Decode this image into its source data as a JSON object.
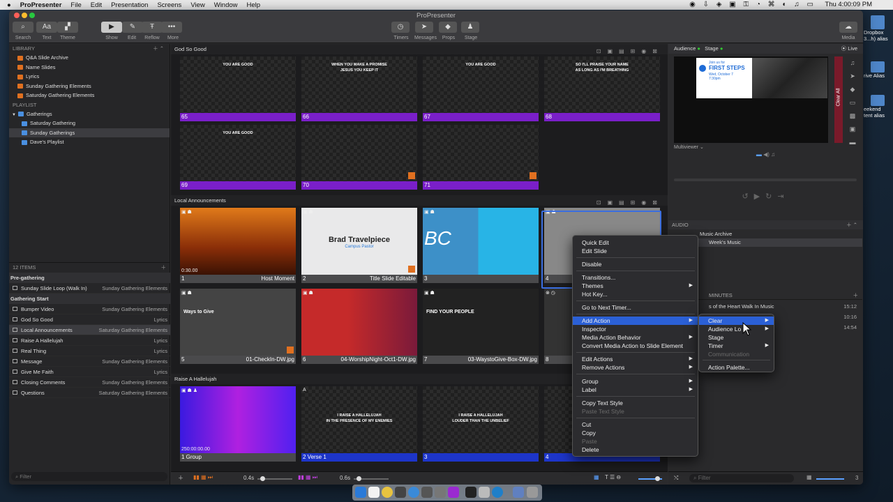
{
  "menubar": {
    "app": "ProPresenter",
    "items": [
      "File",
      "Edit",
      "Presentation",
      "Screens",
      "View",
      "Window",
      "Help"
    ],
    "clock": "Thu 4:00:09 PM"
  },
  "window": {
    "title": "ProPresenter"
  },
  "toolbar": {
    "left": [
      "Search",
      "Text",
      "Theme"
    ],
    "mid": [
      "Show",
      "Edit",
      "Reflow",
      "More"
    ],
    "center": [
      "Timers",
      "Messages",
      "Props",
      "Stage"
    ],
    "right": "Media"
  },
  "library": {
    "header": "LIBRARY",
    "items": [
      "Q&A Slide Archive",
      "Name Slides",
      "Lyrics",
      "Sunday Gathering Elements",
      "Saturday Gathering Elements"
    ]
  },
  "playlist": {
    "header": "PLAYLIST",
    "folder": "Gatherings",
    "items": [
      "Saturday Gathering",
      "Sunday Gatherings",
      "Dave's Playlist"
    ]
  },
  "pl_items": {
    "count": "12 ITEMS",
    "groups": [
      {
        "name": "Pre-gathering",
        "rows": [
          {
            "t": "Sunday Slide Loop (Walk In)",
            "r": "Sunday Gathering Elements"
          }
        ]
      },
      {
        "name": "Gathering Start",
        "rows": [
          {
            "t": "Bumper Video",
            "r": "Sunday Gathering Elements"
          },
          {
            "t": "God So Good",
            "r": "Lyrics"
          },
          {
            "t": "Local Announcements",
            "r": "Saturday Gathering Elements"
          },
          {
            "t": "Raise A Hallelujah",
            "r": "Lyrics"
          },
          {
            "t": "Real Thing",
            "r": "Lyrics"
          },
          {
            "t": "Message",
            "r": "Sunday Gathering Elements"
          },
          {
            "t": "Give Me Faith",
            "r": "Lyrics"
          },
          {
            "t": "Closing Comments",
            "r": "Sunday Gathering Elements"
          },
          {
            "t": "Questions",
            "r": "Saturday Gathering Elements"
          }
        ]
      }
    ]
  },
  "filter": "Filter",
  "sections": [
    "God So Good",
    "Local Announcements",
    "Raise A Hallelujah"
  ],
  "slides_a": [
    {
      "n": "65",
      "lyric": "YOU ARE GOOD"
    },
    {
      "n": "66",
      "lyric": "WHEN YOU MAKE A PROMISE\nJESUS YOU KEEP IT"
    },
    {
      "n": "67",
      "lyric": "YOU ARE GOOD"
    },
    {
      "n": "68",
      "lyric": "SO I'LL PRAISE YOUR NAME\nAS LONG AS I'M BREATHING"
    },
    {
      "n": "69",
      "lyric": "YOU ARE GOOD"
    },
    {
      "n": "70",
      "lyric": ""
    },
    {
      "n": "71",
      "lyric": ""
    }
  ],
  "slides_b": [
    {
      "n": "1",
      "name": "Host Moment",
      "time": "0:30.00"
    },
    {
      "n": "2",
      "name": "Title Slide Editable",
      "title": "Brad Travelpiece",
      "sub": "Campus Pastor"
    },
    {
      "n": "3",
      "name": "",
      "logo": "BC"
    },
    {
      "n": "4",
      "name": ""
    },
    {
      "n": "5",
      "name": "01-CheckIn-DW.jpg",
      "txt": "Ways to Give"
    },
    {
      "n": "6",
      "name": "04-WorshipNight-Oct1-DW.jpg"
    },
    {
      "n": "7",
      "name": "03-WaystoGive-Box-DW.jpg",
      "txt": "FIND YOUR PEOPLE"
    },
    {
      "n": "8",
      "name": ""
    }
  ],
  "slides_c": [
    {
      "n": "1",
      "name": "Group",
      "time": "250:00:00.00"
    },
    {
      "n": "2",
      "name": "Verse 1",
      "lyric": "I RAISE A HALLELUJAH\nIN THE PRESENCE OF MY ENEMIES"
    },
    {
      "n": "3",
      "name": "",
      "lyric": "I RAISE A HALLELUJAH\nLOUDER THAN THE UNBELIEF"
    },
    {
      "n": "4",
      "name": ""
    }
  ],
  "bottom": {
    "speed1": "0.4s",
    "speed2": "0.6s",
    "right_count": "3"
  },
  "right": {
    "audience": "Audience",
    "stage": "Stage",
    "live": "Live",
    "clear_all": "Clear All",
    "multiviewer": "Multiviewer",
    "preview_title": "FIRST STEPS",
    "preview_join": "Join us for",
    "preview_date": "Wed, October 7\n7:30pm",
    "audio_header": "AUDIO",
    "audio_items": [
      "Music Archive",
      "Week's Music"
    ],
    "minutes": "MINUTES",
    "tracks": [
      {
        "t": "s of the Heart Walk In Music",
        "d": "15:12"
      },
      {
        "t": "",
        "d": "10:16"
      },
      {
        "t": "",
        "d": "14:54"
      }
    ]
  },
  "context_menu": {
    "items": [
      "Quick Edit",
      "Edit Slide",
      "Disable",
      "Transitions...",
      "Themes",
      "Hot Key...",
      "Go to Next Timer...",
      "Add Action",
      "Inspector",
      "Media Action Behavior",
      "Convert Media Action to Slide Element",
      "Edit Actions",
      "Remove Actions",
      "Group",
      "Label",
      "Copy Text Style",
      "Paste Text Style",
      "Cut",
      "Copy",
      "Paste",
      "Delete"
    ]
  },
  "submenu": {
    "items": [
      "Clear",
      "Audience Lo",
      "Stage",
      "Timer",
      "Communication",
      "Action Palette..."
    ]
  },
  "desktop": [
    "Dropbox\n3...h) alias",
    "rive Alias",
    "eekend\ntent alias"
  ],
  "colors": {
    "purple": "#7a1fc9",
    "blue": "#1d35c9",
    "highlight": "#2b60d6",
    "orange": "#e07020"
  }
}
